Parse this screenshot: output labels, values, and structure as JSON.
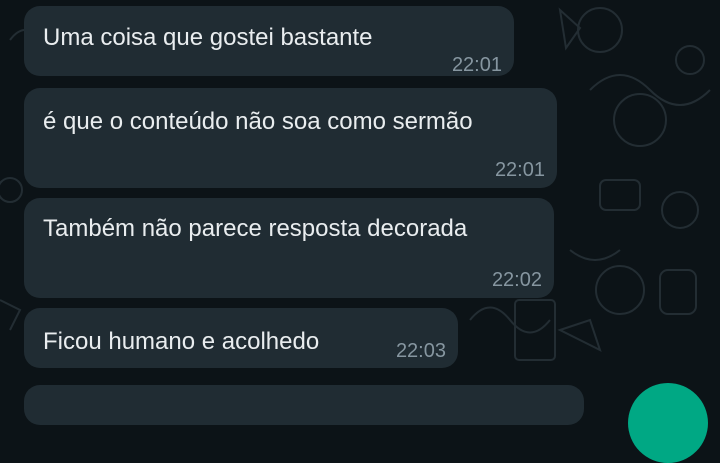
{
  "chat": {
    "messages": [
      {
        "text": "Uma coisa que gostei bastante",
        "time": "22:01"
      },
      {
        "text": "é que o conteúdo não soa como sermão",
        "time": "22:01"
      },
      {
        "text": "Também não parece resposta decorada",
        "time": "22:02"
      },
      {
        "text": "Ficou humano e acolhedo",
        "time": "22:03"
      }
    ]
  },
  "colors": {
    "background": "#0c1317",
    "bubble": "#202c33",
    "text": "#e9edef",
    "timestamp": "#8696a0",
    "accent": "#00a884"
  },
  "icons": [
    "doodle-wallpaper-icon"
  ]
}
